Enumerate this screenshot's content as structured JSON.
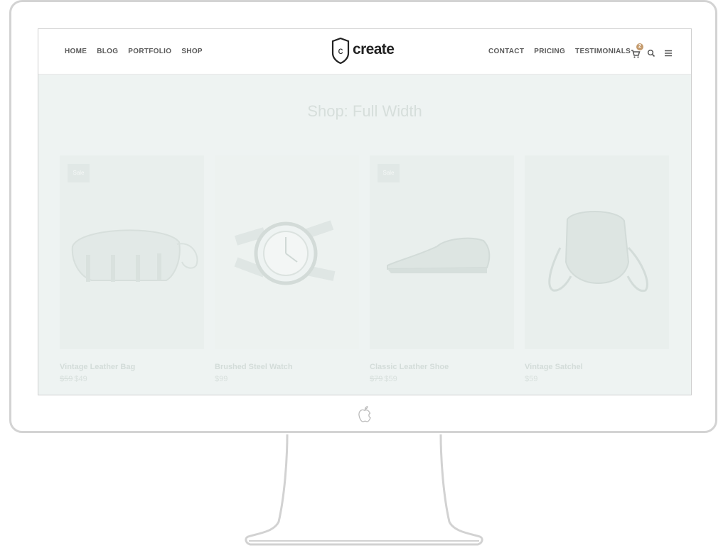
{
  "nav_left": [
    "HOME",
    "BLOG",
    "PORTFOLIO",
    "SHOP"
  ],
  "nav_right": [
    "CONTACT",
    "PRICING",
    "TESTIMONIALS"
  ],
  "logo": {
    "letter": "c",
    "text": "create"
  },
  "cart": {
    "count": "2"
  },
  "page_title": "Shop: Full Width",
  "products": [
    {
      "name": "Vintage Leather Bag",
      "old_price": "$59",
      "price": "$49",
      "sale": "Sale"
    },
    {
      "name": "Brushed Steel Watch",
      "old_price": "",
      "price": "$99",
      "sale": ""
    },
    {
      "name": "Classic Leather Shoe",
      "old_price": "$79",
      "price": "$59",
      "sale": "Sale"
    },
    {
      "name": "Vintage Satchel",
      "old_price": "",
      "price": "$59",
      "sale": ""
    }
  ],
  "colors": {
    "accent": "#c49a6c",
    "overlay": "#eef3f2",
    "nav_text": "#5a5a5a"
  },
  "icons": [
    "cart-icon",
    "search-icon",
    "menu-icon",
    "apple-logo-icon"
  ]
}
